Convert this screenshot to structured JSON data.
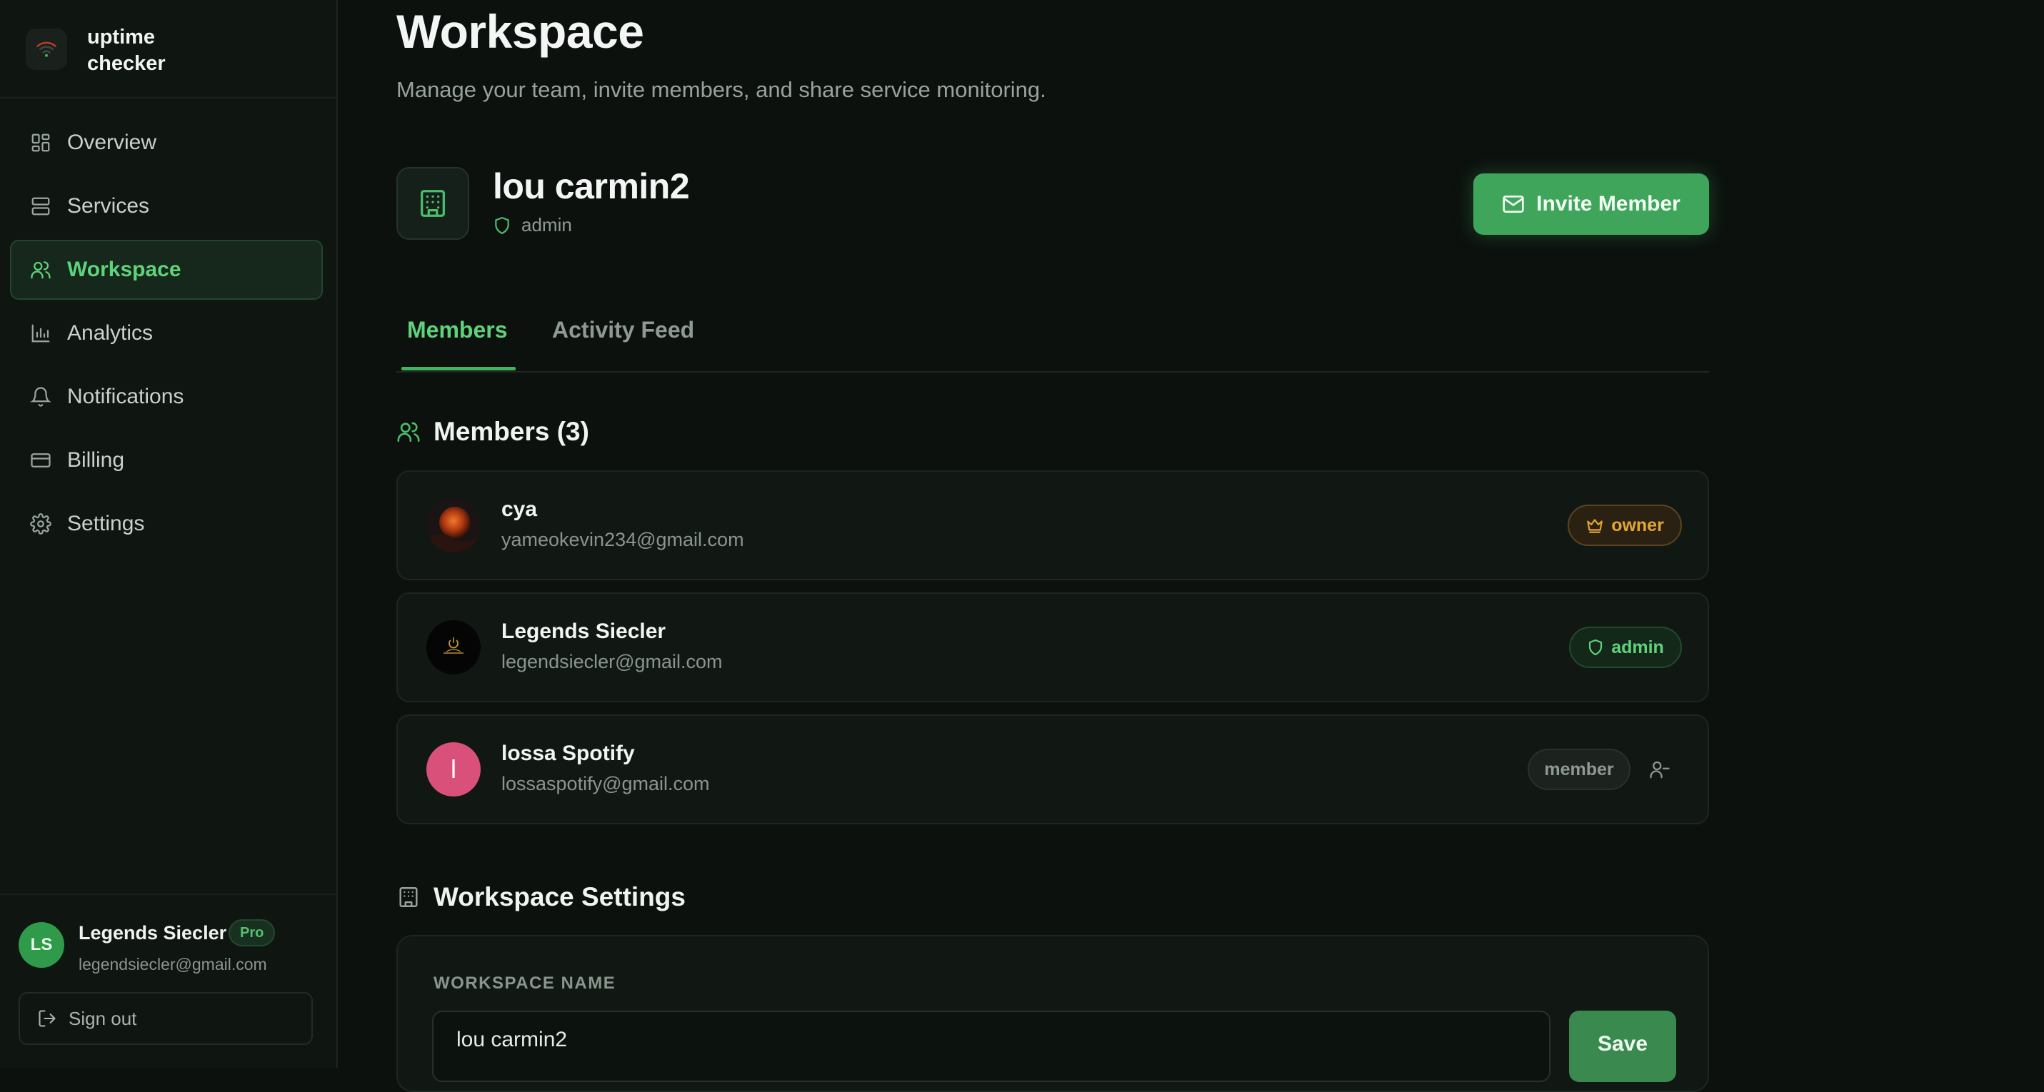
{
  "app": {
    "name": "uptime checker"
  },
  "sidebar": {
    "items": [
      {
        "label": "Overview",
        "icon": "dashboard-icon"
      },
      {
        "label": "Services",
        "icon": "server-icon"
      },
      {
        "label": "Workspace",
        "icon": "users-icon",
        "active": true
      },
      {
        "label": "Analytics",
        "icon": "bar-chart-icon"
      },
      {
        "label": "Notifications",
        "icon": "bell-icon"
      },
      {
        "label": "Billing",
        "icon": "credit-card-icon"
      },
      {
        "label": "Settings",
        "icon": "gear-icon"
      }
    ],
    "user": {
      "initials": "LS",
      "name": "Legends Siecler",
      "plan": "Pro",
      "email": "legendsiecler@gmail.com",
      "sign_out_label": "Sign out"
    }
  },
  "header": {
    "title": "Workspace",
    "subtitle": "Manage your team, invite members, and share service monitoring."
  },
  "workspace": {
    "name": "lou carmin2",
    "role": "admin",
    "invite_label": "Invite Member"
  },
  "tabs": [
    {
      "label": "Members",
      "active": true
    },
    {
      "label": "Activity Feed",
      "active": false
    }
  ],
  "members_section": {
    "title": "Members (3)",
    "members": [
      {
        "name": "cya",
        "email": "yameokevin234@gmail.com",
        "role": "owner"
      },
      {
        "name": "Legends Siecler",
        "email": "legendsiecler@gmail.com",
        "role": "admin"
      },
      {
        "name": "lossa Spotify",
        "email": "lossaspotify@gmail.com",
        "role": "member",
        "initial": "l"
      }
    ]
  },
  "settings_section": {
    "title": "Workspace Settings",
    "field_label": "WORKSPACE NAME",
    "field_value": "lou carmin2",
    "save_label": "Save"
  },
  "colors": {
    "accent": "#3fa55b",
    "active_text": "#5fd37b",
    "owner_badge": "#e3a534",
    "member_avatar": "#d9507a",
    "background": "#0c110e"
  }
}
